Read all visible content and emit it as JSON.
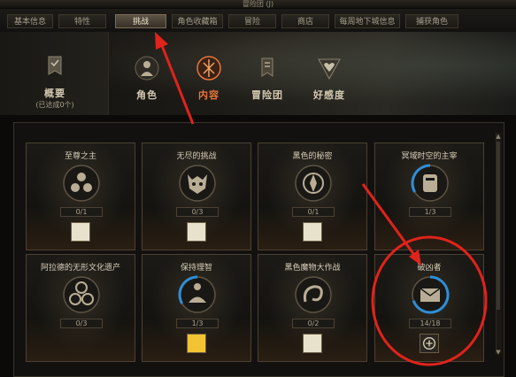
{
  "window": {
    "title": "冒险团 (J)"
  },
  "tabs": [
    {
      "label": "基本信息",
      "active": false
    },
    {
      "label": "特性",
      "active": false
    },
    {
      "label": "挑战",
      "active": true
    },
    {
      "label": "角色收藏箱",
      "active": false
    },
    {
      "label": "冒险",
      "active": false
    },
    {
      "label": "商店",
      "active": false
    },
    {
      "label": "每周地下城信息",
      "active": false
    },
    {
      "label": "捕获角色",
      "active": false
    }
  ],
  "nav": {
    "overview": {
      "label": "概要",
      "sub": "(已达成0个)"
    },
    "items": [
      {
        "label": "角色",
        "icon": "character-icon",
        "active": false
      },
      {
        "label": "内容",
        "icon": "content-icon",
        "active": true
      },
      {
        "label": "冒险团",
        "icon": "banner-icon",
        "active": false
      },
      {
        "label": "好感度",
        "icon": "affinity-icon",
        "active": false
      }
    ]
  },
  "cards": [
    {
      "title": "至尊之主",
      "progress": "0/1",
      "icon": "trinity-icon",
      "reward": "box-reward-icon"
    },
    {
      "title": "无尽的挑战",
      "progress": "0/3",
      "icon": "demon-mask-icon",
      "reward": "box-reward-icon"
    },
    {
      "title": "黑色的秘密",
      "progress": "0/1",
      "icon": "dark-sigil-icon",
      "reward": "box-reward-icon"
    },
    {
      "title": "冥域时空的主宰",
      "progress": "1/3",
      "icon": "golem-icon",
      "reward": "none",
      "progress_fraction": 0.33
    },
    {
      "title": "阿拉德的无形文化遗产",
      "progress": "0/3",
      "icon": "triskelion-icon",
      "reward": "none"
    },
    {
      "title": "保持理智",
      "progress": "1/3",
      "icon": "meditation-icon",
      "reward": "burst-reward-icon",
      "progress_fraction": 0.33
    },
    {
      "title": "黑色魔物大作战",
      "progress": "0/2",
      "icon": "serpent-icon",
      "reward": "box-reward-icon"
    },
    {
      "title": "破凶者",
      "progress": "14/18",
      "icon": "tome-icon",
      "reward": "shield-reward-icon",
      "progress_fraction": 0.78
    }
  ],
  "colors": {
    "accent_active": "#e8763a",
    "annotation_red": "#e0231b",
    "progress_ring": "#2f8fd6"
  }
}
